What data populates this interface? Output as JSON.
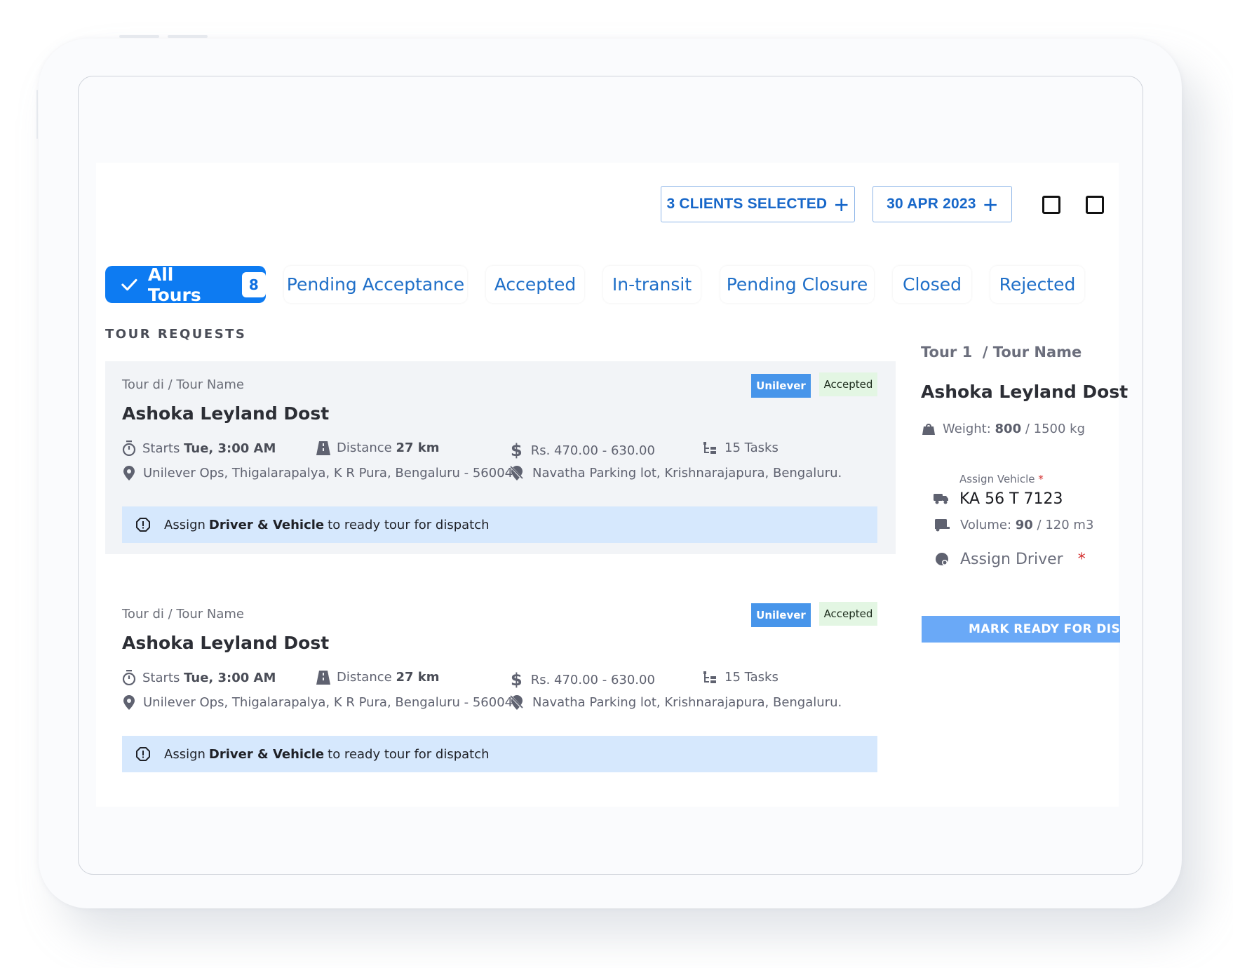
{
  "toolbar": {
    "clients_label": "3 CLIENTS SELECTED",
    "date_label": "30 APR 2023",
    "plus_glyph": "+"
  },
  "tabs": [
    {
      "label": "All Tours",
      "count": "8",
      "active": true
    },
    {
      "label": "Pending Acceptance"
    },
    {
      "label": "Accepted"
    },
    {
      "label": "In-transit"
    },
    {
      "label": "Pending Closure"
    },
    {
      "label": "Closed"
    },
    {
      "label": "Rejected"
    }
  ],
  "section_title": "TOUR REQUESTS",
  "tours": [
    {
      "crumb": "Tour di / Tour Name",
      "title": "Ashoka Leyland Dost",
      "client_badge": "Unilever",
      "status_badge": "Accepted",
      "starts_label": "Starts",
      "starts_value": "Tue, 3:00 AM",
      "distance_label": "Distance",
      "distance_value": "27 km",
      "price": "Rs. 470.00 - 630.00",
      "tasks": "15 Tasks",
      "pickup": "Unilever Ops, Thigalarapalya, K R Pura, Bengaluru - 560049",
      "drop": "Navatha Parking lot, Krishnarajapura, Bengaluru.",
      "alert_pre": "Assign",
      "alert_bold": "Driver & Vehicle",
      "alert_post": "to ready tour for dispatch",
      "selected": true
    },
    {
      "crumb": "Tour di / Tour Name",
      "title": "Ashoka Leyland Dost",
      "client_badge": "Unilever",
      "status_badge": "Accepted",
      "starts_label": "Starts",
      "starts_value": "Tue, 3:00 AM",
      "distance_label": "Distance",
      "distance_value": "27 km",
      "price": "Rs. 470.00 - 630.00",
      "tasks": "15 Tasks",
      "pickup": "Unilever Ops, Thigalarapalya, K R Pura, Bengaluru - 560049",
      "drop": "Navatha Parking lot, Krishnarajapura, Bengaluru.",
      "alert_pre": "Assign",
      "alert_bold": "Driver & Vehicle",
      "alert_post": "to ready tour for dispatch",
      "selected": false
    }
  ],
  "detail": {
    "crumb": "Tour 1  / Tour Name",
    "title": "Ashoka Leyland Dost",
    "weight_label": "Weight:",
    "weight_value": "800",
    "weight_max": "/ 1500 kg",
    "vehicle_label": "Assign Vehicle",
    "required_mark": "*",
    "vehicle_value": "KA 56 T 7123",
    "volume_label": "Volume:",
    "volume_value": "90",
    "volume_max": "/ 120 m3",
    "driver_label": "Assign Driver",
    "dispatch_button": "MARK READY FOR DISPATCH"
  },
  "colors": {
    "primary": "#0d7bf2",
    "link": "#1f6fc8",
    "client_badge": "#4795ea",
    "status_badge_bg": "#e3f6e3",
    "alert_bg": "#d6e8fd",
    "dispatch_button": "#6aa9f7",
    "required": "#d32f2f"
  }
}
